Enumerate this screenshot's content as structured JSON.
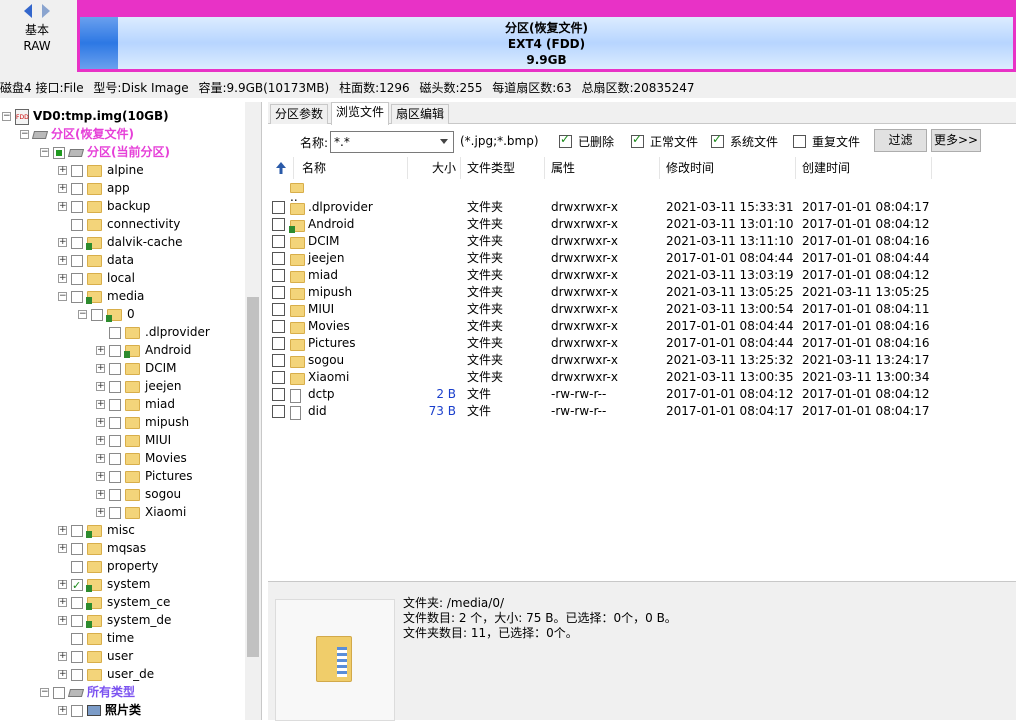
{
  "disk": {
    "nav_line1": "基本",
    "nav_line2": "RAW",
    "partition_name": "分区(恢复文件)",
    "partition_fs": "EXT4 (FDD)",
    "partition_size": "9.9GB",
    "info": [
      "磁盘4 接口:File",
      "型号:Disk Image",
      "容量:9.9GB(10173MB)",
      "柱面数:1296",
      "磁头数:255",
      "每道扇区数:63",
      "总扇区数:20835247"
    ]
  },
  "tree": {
    "root": "VD0:tmp.img(10GB)",
    "partition": "分区(恢复文件)",
    "current_partition": "分区(当前分区)",
    "top_folders": [
      "alpine",
      "app",
      "backup",
      "connectivity",
      "dalvik-cache",
      "data",
      "local",
      "media"
    ],
    "media_child": "0",
    "media0_folders": [
      ".dlprovider",
      "Android",
      "DCIM",
      "jeejen",
      "miad",
      "mipush",
      "MIUI",
      "Movies",
      "Pictures",
      "sogou",
      "Xiaomi"
    ],
    "bottom_folders": [
      "misc",
      "mqsas",
      "property",
      "system",
      "system_ce",
      "system_de",
      "time",
      "user",
      "user_de"
    ],
    "all_types": "所有类型",
    "photo_type": "照片类"
  },
  "tabs": [
    "分区参数",
    "浏览文件",
    "扇区编辑"
  ],
  "filter": {
    "name_label": "名称:",
    "name_value": "*.*",
    "hint": "(*.jpg;*.bmp)",
    "deleted": "已删除",
    "normal": "正常文件",
    "system": "系统文件",
    "duplicate": "重复文件",
    "filter_btn": "过滤",
    "more_btn": "更多>>"
  },
  "columns": {
    "name": "名称",
    "size": "大小",
    "type": "文件类型",
    "attr": "属性",
    "modified": "修改时间",
    "created": "创建时间"
  },
  "parent_dir": "..",
  "files": [
    {
      "name": ".dlprovider",
      "size": "",
      "type": "文件夹",
      "attr": "drwxrwxr-x",
      "modified": "2021-03-11 15:33:31",
      "created": "2017-01-01 08:04:17",
      "kind": "folder"
    },
    {
      "name": "Android",
      "size": "",
      "type": "文件夹",
      "attr": "drwxrwxr-x",
      "modified": "2021-03-11 13:01:10",
      "created": "2017-01-01 08:04:12",
      "kind": "folder-del"
    },
    {
      "name": "DCIM",
      "size": "",
      "type": "文件夹",
      "attr": "drwxrwxr-x",
      "modified": "2021-03-11 13:11:10",
      "created": "2017-01-01 08:04:16",
      "kind": "folder"
    },
    {
      "name": "jeejen",
      "size": "",
      "type": "文件夹",
      "attr": "drwxrwxr-x",
      "modified": "2017-01-01 08:04:44",
      "created": "2017-01-01 08:04:44",
      "kind": "folder"
    },
    {
      "name": "miad",
      "size": "",
      "type": "文件夹",
      "attr": "drwxrwxr-x",
      "modified": "2021-03-11 13:03:19",
      "created": "2017-01-01 08:04:12",
      "kind": "folder"
    },
    {
      "name": "mipush",
      "size": "",
      "type": "文件夹",
      "attr": "drwxrwxr-x",
      "modified": "2021-03-11 13:05:25",
      "created": "2021-03-11 13:05:25",
      "kind": "folder"
    },
    {
      "name": "MIUI",
      "size": "",
      "type": "文件夹",
      "attr": "drwxrwxr-x",
      "modified": "2021-03-11 13:00:54",
      "created": "2017-01-01 08:04:11",
      "kind": "folder"
    },
    {
      "name": "Movies",
      "size": "",
      "type": "文件夹",
      "attr": "drwxrwxr-x",
      "modified": "2017-01-01 08:04:44",
      "created": "2017-01-01 08:04:16",
      "kind": "folder"
    },
    {
      "name": "Pictures",
      "size": "",
      "type": "文件夹",
      "attr": "drwxrwxr-x",
      "modified": "2017-01-01 08:04:44",
      "created": "2017-01-01 08:04:16",
      "kind": "folder"
    },
    {
      "name": "sogou",
      "size": "",
      "type": "文件夹",
      "attr": "drwxrwxr-x",
      "modified": "2021-03-11 13:25:32",
      "created": "2021-03-11 13:24:17",
      "kind": "folder"
    },
    {
      "name": "Xiaomi",
      "size": "",
      "type": "文件夹",
      "attr": "drwxrwxr-x",
      "modified": "2021-03-11 13:00:35",
      "created": "2021-03-11 13:00:34",
      "kind": "folder"
    },
    {
      "name": "dctp",
      "size": "2 B",
      "type": "文件",
      "attr": "-rw-rw-r--",
      "modified": "2017-01-01 08:04:12",
      "created": "2017-01-01 08:04:12",
      "kind": "file"
    },
    {
      "name": "did",
      "size": "73 B",
      "type": "文件",
      "attr": "-rw-rw-r--",
      "modified": "2017-01-01 08:04:17",
      "created": "2017-01-01 08:04:17",
      "kind": "file"
    }
  ],
  "bottom": {
    "folder_path": "文件夹: /media/0/",
    "file_count": "文件数目: 2 个，大小: 75 B。已选择：0个，0 B。",
    "folder_count": "文件夹数目: 11，已选择：0个。"
  },
  "colors": {
    "partition_border": "#e832c6",
    "partition_label": "#e640d8",
    "all_types_label": "#7b52f0",
    "size_text": "#1a3fcc"
  }
}
